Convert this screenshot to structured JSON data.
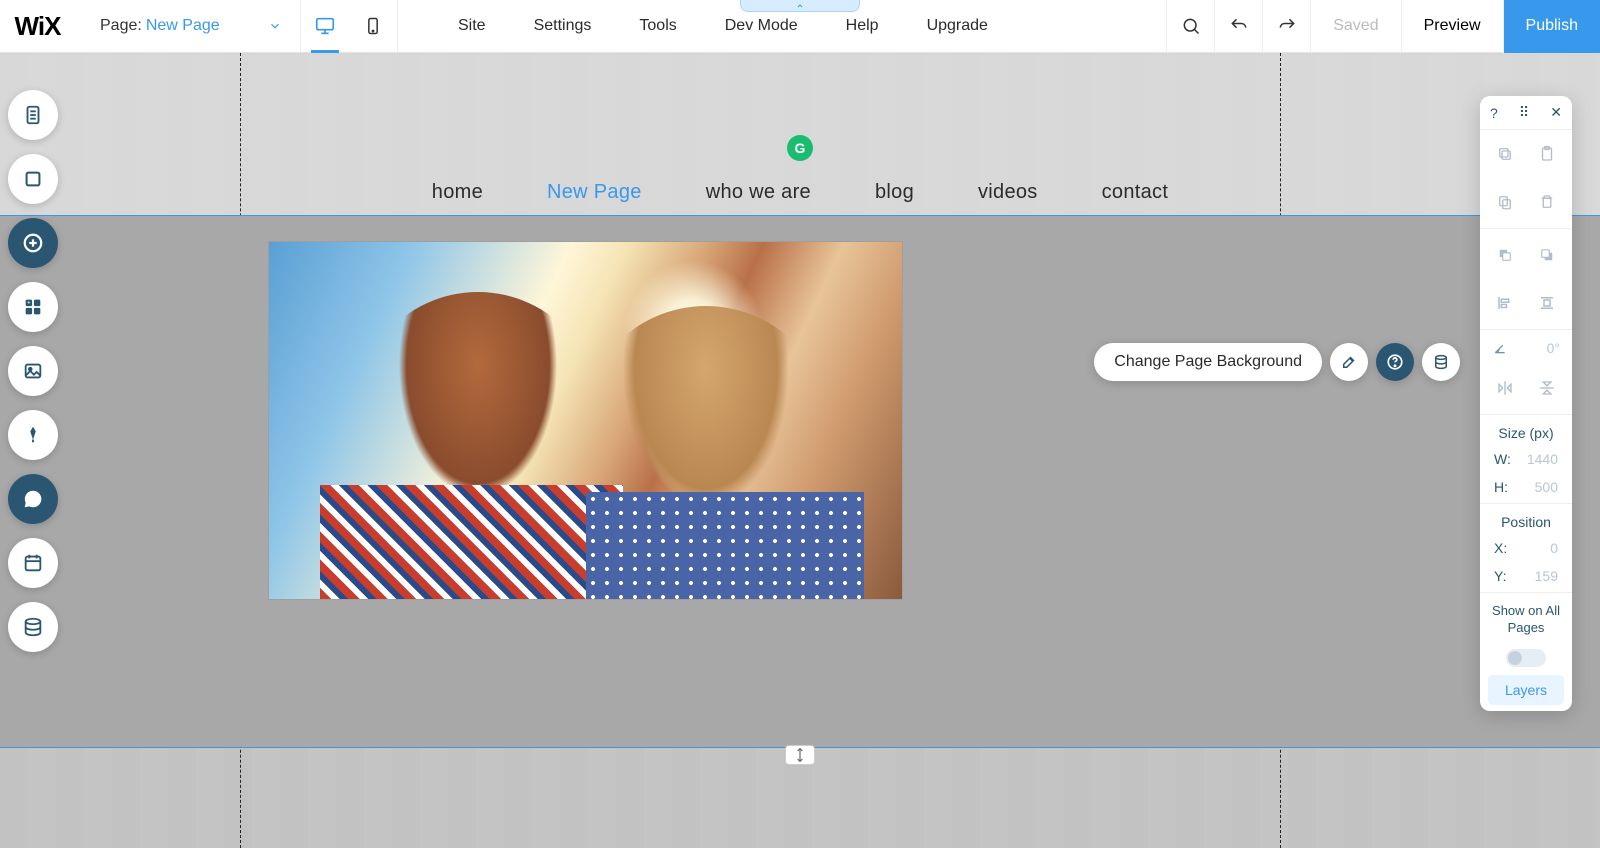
{
  "topbar": {
    "logo": "WiX",
    "page_label": "Page:",
    "page_name": "New Page",
    "menu": [
      "Site",
      "Settings",
      "Tools",
      "Dev Mode",
      "Help",
      "Upgrade"
    ],
    "saved": "Saved",
    "preview": "Preview",
    "publish": "Publish"
  },
  "nav": {
    "items": [
      "home",
      "New Page",
      "who we are",
      "blog",
      "videos",
      "contact"
    ],
    "active_index": 1
  },
  "context": {
    "change_bg": "Change Page Background"
  },
  "g_badge": "G",
  "right_panel": {
    "angle_value": "0°",
    "size_title": "Size (px)",
    "w_label": "W:",
    "w_value": "1440",
    "h_label": "H:",
    "h_value": "500",
    "pos_title": "Position",
    "x_label": "X:",
    "x_value": "0",
    "y_label": "Y:",
    "y_value": "159",
    "show_label": "Show on All Pages",
    "layers": "Layers"
  }
}
